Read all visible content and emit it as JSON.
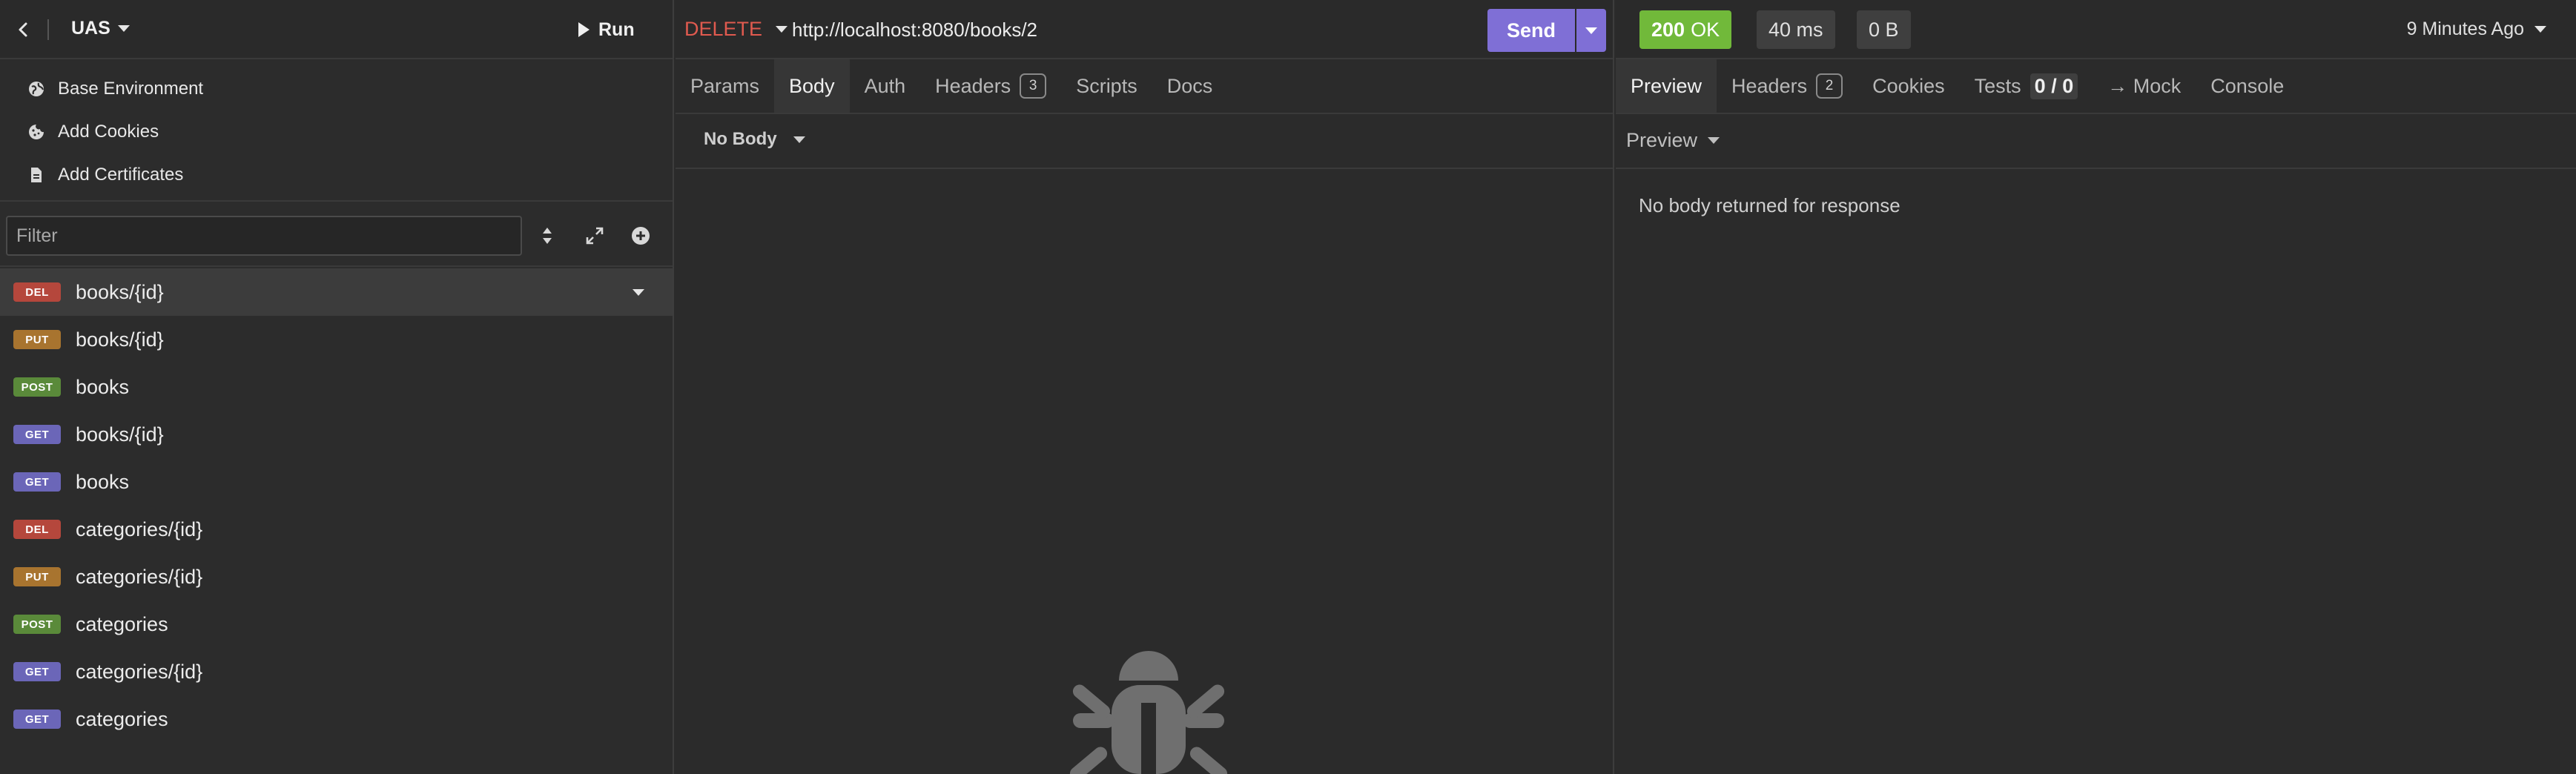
{
  "sidebar": {
    "workspace": "UAS",
    "run_label": "Run",
    "env_items": [
      {
        "label": "Base Environment",
        "icon": "globe-icon"
      },
      {
        "label": "Add Cookies",
        "icon": "cookie-icon"
      },
      {
        "label": "Add Certificates",
        "icon": "certificate-icon"
      }
    ],
    "filter_placeholder": "Filter",
    "requests": [
      {
        "method": "DEL",
        "name": "books/{id}",
        "color": "#b5473c"
      },
      {
        "method": "PUT",
        "name": "books/{id}",
        "color": "#a8742f"
      },
      {
        "method": "POST",
        "name": "books",
        "color": "#5a8a3a"
      },
      {
        "method": "GET",
        "name": "books/{id}",
        "color": "#6b66b8"
      },
      {
        "method": "GET",
        "name": "books",
        "color": "#6b66b8"
      },
      {
        "method": "DEL",
        "name": "categories/{id}",
        "color": "#b5473c"
      },
      {
        "method": "PUT",
        "name": "categories/{id}",
        "color": "#a8742f"
      },
      {
        "method": "POST",
        "name": "categories",
        "color": "#5a8a3a"
      },
      {
        "method": "GET",
        "name": "categories/{id}",
        "color": "#6b66b8"
      },
      {
        "method": "GET",
        "name": "categories",
        "color": "#6b66b8"
      }
    ]
  },
  "request": {
    "method": "DELETE",
    "url": "http://localhost:8080/books/2",
    "send_label": "Send",
    "tabs": {
      "params": "Params",
      "body": "Body",
      "auth": "Auth",
      "headers": "Headers",
      "headers_count": "3",
      "scripts": "Scripts",
      "docs": "Docs"
    },
    "body_type": "No Body"
  },
  "response": {
    "status_code": "200",
    "status_text": "OK",
    "time": "40 ms",
    "size": "0 B",
    "time_ago": "9 Minutes Ago",
    "tabs": {
      "preview": "Preview",
      "headers": "Headers",
      "headers_count": "2",
      "cookies": "Cookies",
      "tests": "Tests",
      "tests_count": "0 / 0",
      "mock": "→ Mock",
      "console": "Console"
    },
    "preview_mode": "Preview",
    "empty_message": "No body returned for response"
  },
  "colors": {
    "accent": "#7f6fd6",
    "status_ok": "#71b93a",
    "delete": "#e05a4f"
  }
}
